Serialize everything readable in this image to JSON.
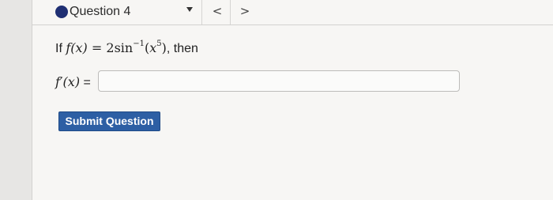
{
  "question": {
    "title": "Question 4",
    "status_color": "#1f2f73"
  },
  "navigation": {
    "prev_label": "<",
    "next_label": ">",
    "dropdown_icon": "caret-down-icon"
  },
  "prompt": {
    "prefix": "If",
    "function": "f(x)",
    "equals": "=",
    "expression_coefficient": "2",
    "expression_func": "sin",
    "expression_exponent": "−1",
    "expression_arg_base": "x",
    "expression_arg_exp": "5",
    "suffix": ", then"
  },
  "answer": {
    "label_func": "f′(x)",
    "label_equals": "=",
    "value": ""
  },
  "submit": {
    "label": "Submit Question",
    "color": "#2d5fa4"
  }
}
